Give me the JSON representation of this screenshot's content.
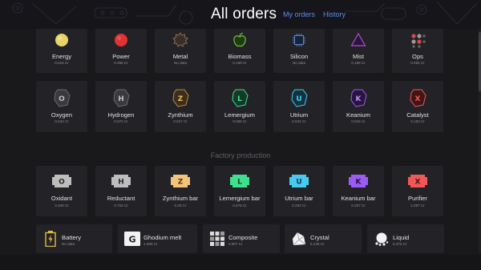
{
  "header": {
    "title": "All orders",
    "links": {
      "my_orders": "My orders",
      "history": "History"
    }
  },
  "basic": [
    {
      "name": "Energy",
      "price": "0.016 Cr",
      "icon": "energy-orb-icon",
      "color": "#e6d46a"
    },
    {
      "name": "Power",
      "price": "0.356 Cr",
      "icon": "power-orb-icon",
      "color": "#e03333"
    },
    {
      "name": "Metal",
      "price": "No data",
      "icon": "metal-gear-icon",
      "color": "#7a5a4a"
    },
    {
      "name": "Biomass",
      "price": "0.199 Cr",
      "icon": "biomass-apple-icon",
      "color": "#6fc03c"
    },
    {
      "name": "Silicon",
      "price": "No data",
      "icon": "silicon-chip-icon",
      "color": "#5f86c9"
    },
    {
      "name": "Mist",
      "price": "0.198 Cr",
      "icon": "mist-triangle-icon",
      "color": "#b04ad8"
    },
    {
      "name": "Ops",
      "price": "0.092 Cr",
      "icon": "ops-dots-icon",
      "color": "#d84848"
    }
  ],
  "minerals": [
    {
      "name": "Oxygen",
      "price": "0.042 Cr",
      "letter": "O",
      "color": "#bdbdbd",
      "icon": "oxygen-mineral-icon"
    },
    {
      "name": "Hydrogen",
      "price": "0.072 Cr",
      "letter": "H",
      "color": "#bdbdbd",
      "icon": "hydrogen-mineral-icon"
    },
    {
      "name": "Zynthium",
      "price": "0.027 Cr",
      "letter": "Z",
      "color": "#f0b85a",
      "icon": "zynthium-mineral-icon"
    },
    {
      "name": "Lemergium",
      "price": "0.095 Cr",
      "letter": "L",
      "color": "#3ee08e",
      "icon": "lemergium-mineral-icon"
    },
    {
      "name": "Utrium",
      "price": "0.041 Cr",
      "letter": "U",
      "color": "#48c9ef",
      "icon": "utrium-mineral-icon"
    },
    {
      "name": "Keanium",
      "price": "0.016 Cr",
      "letter": "K",
      "color": "#9b5cf0",
      "icon": "keanium-mineral-icon"
    },
    {
      "name": "Catalyst",
      "price": "0.153 Cr",
      "letter": "X",
      "color": "#f05858",
      "icon": "catalyst-mineral-icon"
    }
  ],
  "section_title": "Factory production",
  "bars": [
    {
      "name": "Oxidant",
      "price": "0.469 Cr",
      "letter": "O",
      "color": "#bdbdbd",
      "icon": "oxidant-bar-icon"
    },
    {
      "name": "Reductant",
      "price": "0.704 Cr",
      "letter": "H",
      "color": "#bdbdbd",
      "icon": "reductant-bar-icon"
    },
    {
      "name": "Zynthium bar",
      "price": "0.29 Cr",
      "letter": "Z",
      "color": "#f3c37a",
      "icon": "zynthium-bar-icon"
    },
    {
      "name": "Lemergium bar",
      "price": "0.576 Cr",
      "letter": "L",
      "color": "#3ee08e",
      "icon": "lemergium-bar-icon"
    },
    {
      "name": "Utrium bar",
      "price": "0.294 Cr",
      "letter": "U",
      "color": "#48c9ef",
      "icon": "utrium-bar-icon"
    },
    {
      "name": "Keanium bar",
      "price": "0.287 Cr",
      "letter": "K",
      "color": "#9b5cf0",
      "icon": "keanium-bar-icon"
    },
    {
      "name": "Purifier",
      "price": "1.097 Cr",
      "letter": "X",
      "color": "#f05858",
      "icon": "purifier-bar-icon"
    }
  ],
  "commodities": [
    {
      "name": "Battery",
      "price": "No data",
      "icon": "battery-icon"
    },
    {
      "name": "Ghodium melt",
      "price": "1.595 Cr",
      "icon": "ghodium-melt-icon"
    },
    {
      "name": "Composite",
      "price": "0.807 Cr",
      "icon": "composite-icon"
    },
    {
      "name": "Crystal",
      "price": "5.246 Cr",
      "icon": "crystal-icon"
    },
    {
      "name": "Liquid",
      "price": "5.375 Cr",
      "icon": "liquid-icon"
    }
  ]
}
